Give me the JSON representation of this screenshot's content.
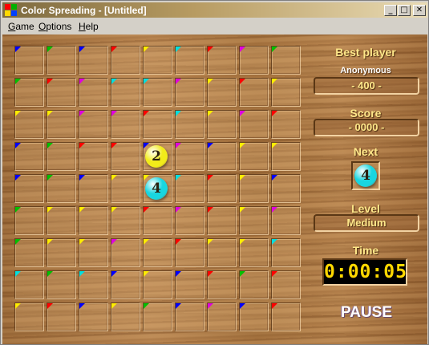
{
  "window": {
    "title": "Color Spreading - [Untitled]",
    "controls": {
      "minimize": "_",
      "maximize": "□",
      "close": "✕"
    }
  },
  "menu": [
    {
      "label": "Game",
      "access_key": "G"
    },
    {
      "label": "Options",
      "access_key": "O"
    },
    {
      "label": "Help",
      "access_key": "H"
    }
  ],
  "colors": {
    "R": "#ff0000",
    "G": "#00c000",
    "B": "#0000ff",
    "Y": "#ffee00",
    "M": "#e000e0",
    "C": "#00e0e0"
  },
  "board": {
    "rows": 9,
    "cols": 9,
    "corner_colors": [
      [
        "B",
        "G",
        "B",
        "R",
        "Y",
        "C",
        "R",
        "M",
        "G"
      ],
      [
        "G",
        "R",
        "M",
        "C",
        "C",
        "M",
        "Y",
        "R",
        "Y"
      ],
      [
        "Y",
        "Y",
        "M",
        "M",
        "R",
        "C",
        "Y",
        "M",
        "R"
      ],
      [
        "B",
        "G",
        "R",
        "R",
        "B",
        "M",
        "B",
        "Y",
        "Y"
      ],
      [
        "B",
        "G",
        "B",
        "Y",
        "Y",
        "C",
        "R",
        "Y",
        "B"
      ],
      [
        "G",
        "Y",
        "Y",
        "Y",
        "R",
        "M",
        "R",
        "Y",
        "M"
      ],
      [
        "G",
        "Y",
        "Y",
        "M",
        "Y",
        "R",
        "Y",
        "Y",
        "C"
      ],
      [
        "C",
        "G",
        "C",
        "B",
        "Y",
        "B",
        "R",
        "G",
        "R"
      ],
      [
        "Y",
        "R",
        "B",
        "Y",
        "G",
        "B",
        "M",
        "B",
        "R"
      ]
    ],
    "balls": [
      {
        "row": 3,
        "col": 4,
        "number": "2",
        "color": "#f2ec1a"
      },
      {
        "row": 4,
        "col": 4,
        "number": "4",
        "color": "#18d6e0"
      }
    ]
  },
  "panel": {
    "best_player_label": "Best player",
    "best_player_name": "Anonymous",
    "best_score": "- 400 -",
    "score_label": "Score",
    "score_value": "- 0000 -",
    "next_label": "Next",
    "next_ball": {
      "number": "4",
      "color": "#18d6e0"
    },
    "level_label": "Level",
    "level_value": "Medium",
    "time_label": "Time",
    "time_value": "0:00:05",
    "pause_label": "PAUSE"
  }
}
